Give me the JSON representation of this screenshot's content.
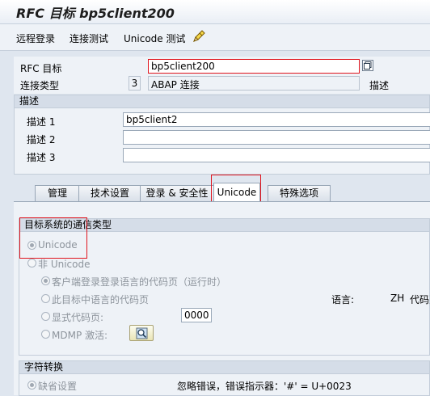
{
  "title": "RFC 目标 bp5client200",
  "toolbar": {
    "remote_login": "远程登录",
    "connection_test": "连接测试",
    "unicode_test": "Unicode 测试"
  },
  "header": {
    "rfc_dest_label": "RFC 目标",
    "rfc_dest_value": "bp5client200",
    "conn_type_label": "连接类型",
    "conn_type_code": "3",
    "conn_type_text": "ABAP 连接",
    "desc_label": "描述"
  },
  "description": {
    "group_title": "描述",
    "desc1_label": "描述 1",
    "desc1_value": "bp5client2",
    "desc2_label": "描述 2",
    "desc2_value": "",
    "desc3_label": "描述 3",
    "desc3_value": ""
  },
  "tabs": [
    "管理",
    "技术设置",
    "登录 & 安全性",
    "Unicode",
    "特殊选项"
  ],
  "active_tab": "Unicode",
  "unicode": {
    "group_title": "目标系统的通信类型",
    "opt_unicode": "Unicode",
    "opt_non_unicode": "非 Unicode",
    "sub_client_codepage": "客户端登录登录语言的代码页（运行时）",
    "sub_target_lang_codepage": "此目标中语言的代码页",
    "sub_explicit_codepage": "显式代码页:",
    "explicit_codepage_value": "0000",
    "sub_mdmp": "MDMP 激活:",
    "language_label": "语言:",
    "language_value": "ZH",
    "codepage_label": "代码页"
  },
  "conversion": {
    "group_title": "字符转换",
    "opt_default": "缺省设置",
    "default_text": "忽略错误，错误指示器：'#' = U+0023"
  },
  "colors": {
    "highlight_box": "#e0141d",
    "panel_bg": "#eef2f7"
  }
}
